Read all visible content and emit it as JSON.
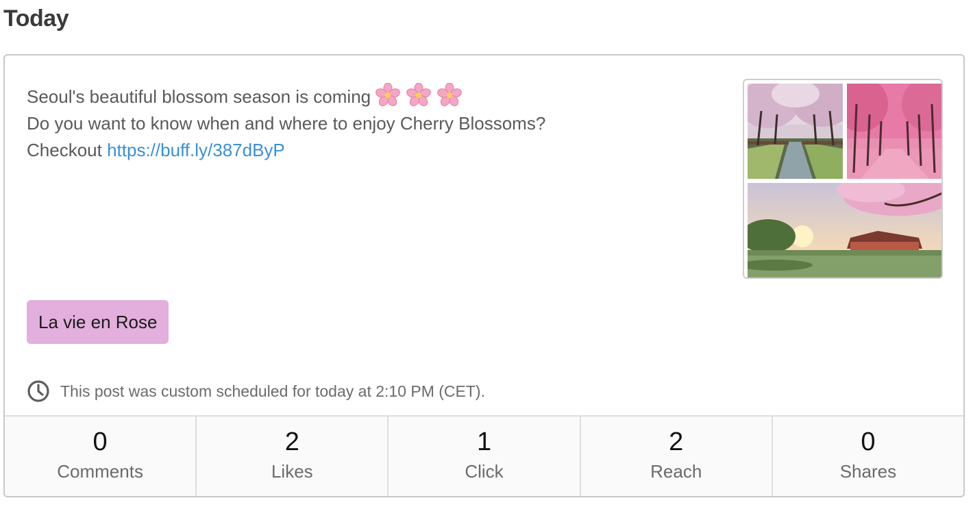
{
  "heading": "Today",
  "post": {
    "line1": "Seoul's beautiful blossom season is coming",
    "line2": "Do you want to know when and where to enjoy Cherry Blossoms?",
    "line3_prefix": "Checkout ",
    "link": "https://buff.ly/387dByP",
    "emoji_icon": "cherry-blossom-icon",
    "emoji_count": 3
  },
  "media": {
    "images": [
      "cherry-blossom-canal-photo",
      "pink-tree-avenue-photo",
      "palace-pond-blossom-photo"
    ]
  },
  "tag": {
    "label": "La vie en Rose",
    "color": "#e3afdc"
  },
  "schedule": {
    "icon": "clock-icon",
    "text": "This post was custom scheduled for today at 2:10 PM (CET)."
  },
  "stats": [
    {
      "value": "0",
      "label": "Comments"
    },
    {
      "value": "2",
      "label": "Likes"
    },
    {
      "value": "1",
      "label": "Click"
    },
    {
      "value": "2",
      "label": "Reach"
    },
    {
      "value": "0",
      "label": "Shares"
    }
  ],
  "colors": {
    "link": "#3a8fd6",
    "border": "#c8c8c8",
    "text": "#595959"
  }
}
